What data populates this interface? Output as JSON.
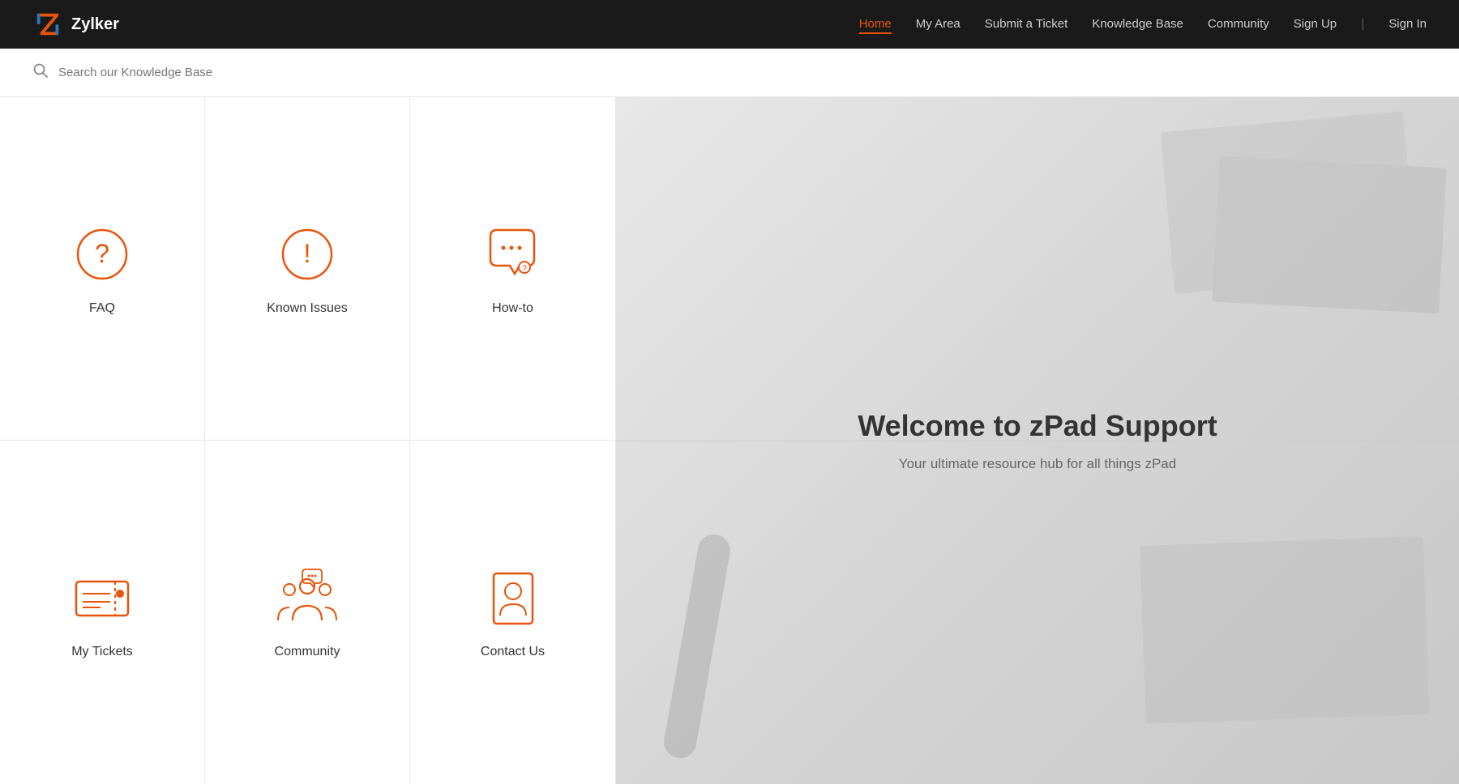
{
  "brand": {
    "name": "Zylker"
  },
  "nav": {
    "items": [
      {
        "label": "Home",
        "active": true
      },
      {
        "label": "My Area",
        "active": false
      },
      {
        "label": "Submit a Ticket",
        "active": false
      },
      {
        "label": "Knowledge Base",
        "active": false
      },
      {
        "label": "Community",
        "active": false
      },
      {
        "label": "Sign Up",
        "active": false
      },
      {
        "label": "Sign In",
        "active": false
      }
    ]
  },
  "search": {
    "placeholder": "Search our Knowledge Base"
  },
  "categories": [
    {
      "label": "FAQ",
      "icon": "faq"
    },
    {
      "label": "Known Issues",
      "icon": "known-issues"
    },
    {
      "label": "How-to",
      "icon": "how-to"
    },
    {
      "label": "My Tickets",
      "icon": "my-tickets"
    },
    {
      "label": "Community",
      "icon": "community"
    },
    {
      "label": "Contact Us",
      "icon": "contact-us"
    }
  ],
  "hero": {
    "title": "Welcome to zPad Support",
    "subtitle": "Your ultimate resource hub for all things zPad"
  }
}
